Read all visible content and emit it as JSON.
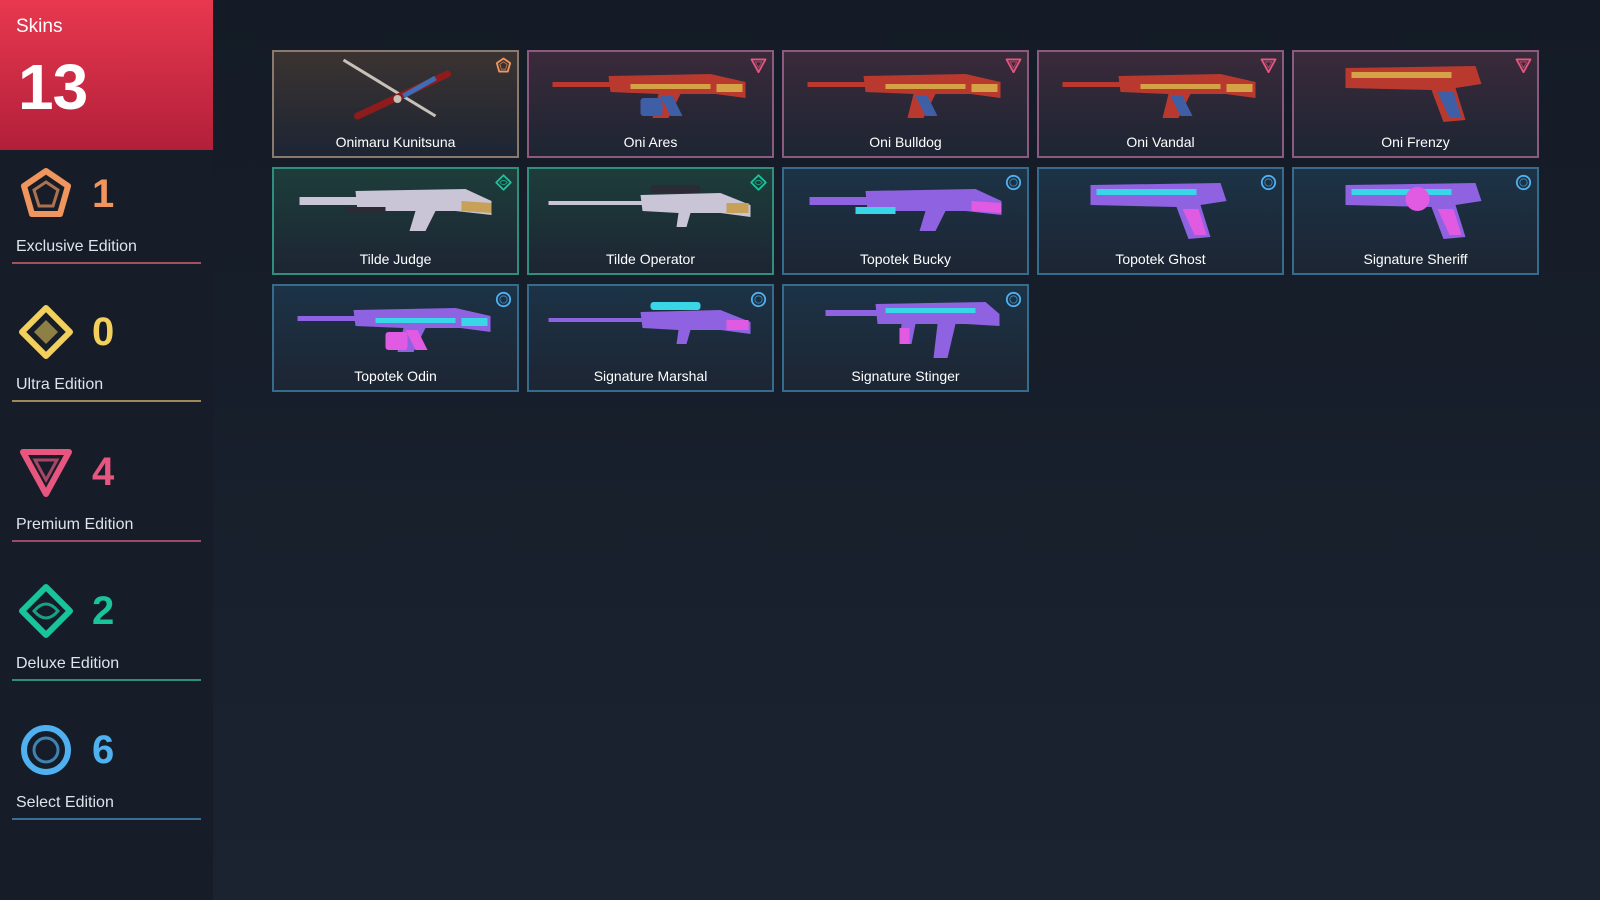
{
  "summary": {
    "label": "Skins",
    "total": "13"
  },
  "tiers": [
    {
      "key": "exclusive",
      "count": "1",
      "label": "Exclusive Edition",
      "icon": "exclusive-edition-icon",
      "color": "#f0955e",
      "line": "#a3525c"
    },
    {
      "key": "ultra",
      "count": "0",
      "label": "Ultra Edition",
      "icon": "ultra-edition-icon",
      "color": "#f3cf5c",
      "line": "#9e8a56"
    },
    {
      "key": "premium",
      "count": "4",
      "label": "Premium Edition",
      "icon": "premium-edition-icon",
      "color": "#e7567f",
      "line": "#9c4a66"
    },
    {
      "key": "deluxe",
      "count": "2",
      "label": "Deluxe Edition",
      "icon": "deluxe-edition-icon",
      "color": "#19c49b",
      "line": "#2c8f7a"
    },
    {
      "key": "select",
      "count": "6",
      "label": "Select Edition",
      "icon": "select-edition-icon",
      "color": "#4fb1f0",
      "line": "#3b6e95"
    }
  ],
  "skins": [
    {
      "name": "Onimaru Kunitsuna",
      "tier": "exclusive",
      "weapon": "katana"
    },
    {
      "name": "Oni Ares",
      "tier": "premium",
      "weapon": "lmg"
    },
    {
      "name": "Oni Bulldog",
      "tier": "premium",
      "weapon": "rifle"
    },
    {
      "name": "Oni Vandal",
      "tier": "premium",
      "weapon": "rifle"
    },
    {
      "name": "Oni Frenzy",
      "tier": "premium",
      "weapon": "pistol"
    },
    {
      "name": "Tilde Judge",
      "tier": "deluxe",
      "weapon": "shotgun"
    },
    {
      "name": "Tilde Operator",
      "tier": "deluxe",
      "weapon": "sniper"
    },
    {
      "name": "Topotek Bucky",
      "tier": "select",
      "weapon": "shotgun"
    },
    {
      "name": "Topotek Ghost",
      "tier": "select",
      "weapon": "pistol"
    },
    {
      "name": "Signature Sheriff",
      "tier": "select",
      "weapon": "revolver"
    },
    {
      "name": "Topotek Odin",
      "tier": "select",
      "weapon": "lmg"
    },
    {
      "name": "Signature Marshal",
      "tier": "select",
      "weapon": "sniper"
    },
    {
      "name": "Signature Stinger",
      "tier": "select",
      "weapon": "smg"
    }
  ],
  "card_themes": {
    "exclusive": {
      "bg": "#3b3331",
      "border": "#8a7a6e"
    },
    "premium": {
      "bg": "#3a2a3a",
      "border": "#8b5a7e"
    },
    "deluxe": {
      "bg": "#1d3d3a",
      "border": "#2f8e7e"
    },
    "select": {
      "bg": "#1c3346",
      "border": "#356b8c"
    }
  }
}
